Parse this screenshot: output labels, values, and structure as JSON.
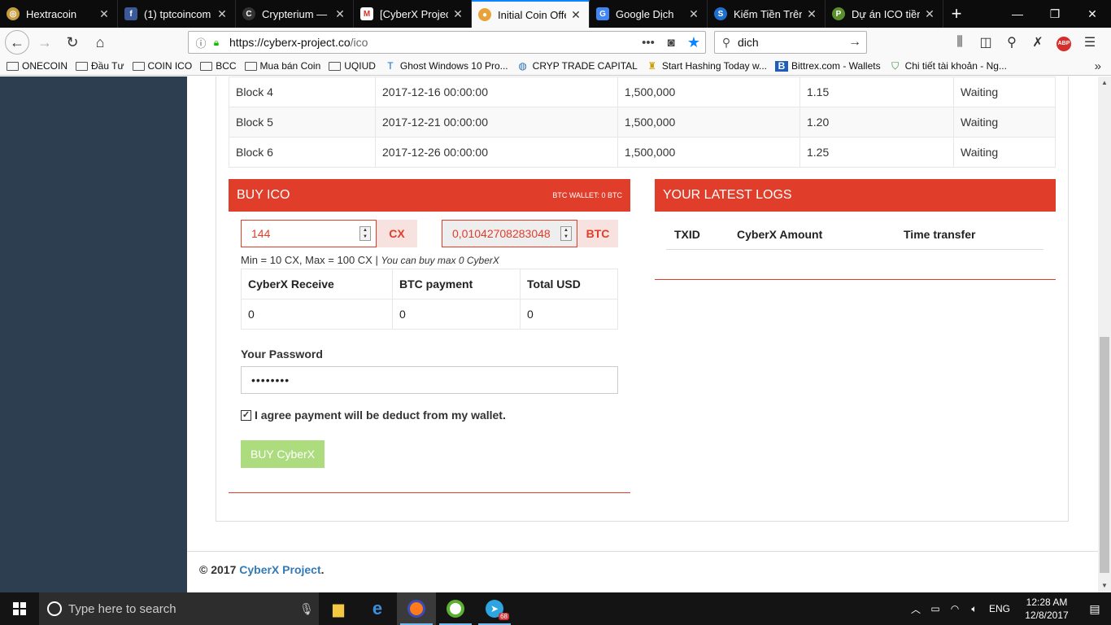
{
  "browser": {
    "tabs": [
      {
        "title": "Hextracoin",
        "icon": "hextracoin-icon",
        "color": "#c89b3c",
        "active": false
      },
      {
        "title": "(1) tptcoincom",
        "icon": "facebook-icon",
        "color": "#3b5998",
        "active": false
      },
      {
        "title": "Crypterium — C",
        "icon": "crypterium-icon",
        "color": "#222222",
        "active": false
      },
      {
        "title": "[CyberX Project",
        "icon": "gmail-icon",
        "color": "#d93025",
        "active": false
      },
      {
        "title": "Initial Coin Offe",
        "icon": "cyberx-icon",
        "color": "#e8a23a",
        "active": true
      },
      {
        "title": "Google Dịch",
        "icon": "google-translate-icon",
        "color": "#4285f4",
        "active": false
      },
      {
        "title": "Kiếm Tiền Trên I",
        "icon": "site-icon",
        "color": "#1f6fd0",
        "active": false
      },
      {
        "title": "Dự án ICO tiềm",
        "icon": "site-icon",
        "color": "#5a8f2c",
        "active": false
      }
    ],
    "url_domain": "https://cyberx-project.co",
    "url_path": "/ico",
    "search_value": "dich",
    "bookmarks": [
      {
        "label": "ONECOIN",
        "type": "folder"
      },
      {
        "label": "Đầu Tư",
        "type": "folder"
      },
      {
        "label": "COIN ICO",
        "type": "folder"
      },
      {
        "label": "BCC",
        "type": "folder"
      },
      {
        "label": "Mua bán Coin",
        "type": "folder"
      },
      {
        "label": "UQIUD",
        "type": "folder"
      },
      {
        "label": "Ghost Windows 10 Pro...",
        "type": "link",
        "icon": "ghost-icon"
      },
      {
        "label": "CRYP TRADE CAPITAL",
        "type": "link",
        "icon": "globe-icon"
      },
      {
        "label": "Start Hashing Today w...",
        "type": "link",
        "icon": "hash-icon"
      },
      {
        "label": "Bittrex.com - Wallets",
        "type": "link",
        "icon": "bittrex-icon"
      },
      {
        "label": "Chi tiết tài khoản - Ng...",
        "type": "link",
        "icon": "shield-icon"
      }
    ]
  },
  "blocks": [
    {
      "name": "Block 4",
      "date": "2017-12-16 00:00:00",
      "amount": "1,500,000",
      "price": "1.15",
      "status": "Waiting"
    },
    {
      "name": "Block 5",
      "date": "2017-12-21 00:00:00",
      "amount": "1,500,000",
      "price": "1.20",
      "status": "Waiting"
    },
    {
      "name": "Block 6",
      "date": "2017-12-26 00:00:00",
      "amount": "1,500,000",
      "price": "1.25",
      "status": "Waiting"
    }
  ],
  "buy": {
    "title": "BUY ICO",
    "wallet": "BTC WALLET: 0 BTC",
    "cx_value": "144",
    "cx_unit": "CX",
    "btc_value": "0,01042708283048",
    "btc_unit": "BTC",
    "minmax": "Min = 10 CX, Max = 100 CX | ",
    "maxnote": "You can buy max 0 CyberX",
    "headers": [
      "CyberX Receive",
      "BTC payment",
      "Total USD"
    ],
    "values": [
      "0",
      "0",
      "0"
    ],
    "password_label": "Your Password",
    "password_mask": "••••••••",
    "agree_label": "I agree payment will be deduct from my wallet.",
    "agree_checked": true,
    "button_label": "BUY CyberX"
  },
  "logs": {
    "title": "YOUR LATEST LOGS",
    "headers": [
      "TXID",
      "CyberX Amount",
      "Time transfer"
    ]
  },
  "footer": {
    "prefix": "© 2017 ",
    "link": "CyberX Project",
    "suffix": "."
  },
  "taskbar": {
    "search_placeholder": "Type here to search",
    "language": "ENG",
    "time": "12:28 AM",
    "date": "12/8/2017",
    "telegram_badge": "68"
  },
  "colors": {
    "accent_red": "#e13d2b",
    "sidebar": "#2c3e50",
    "link_blue": "#337ab7",
    "button_green": "#addc7e"
  }
}
